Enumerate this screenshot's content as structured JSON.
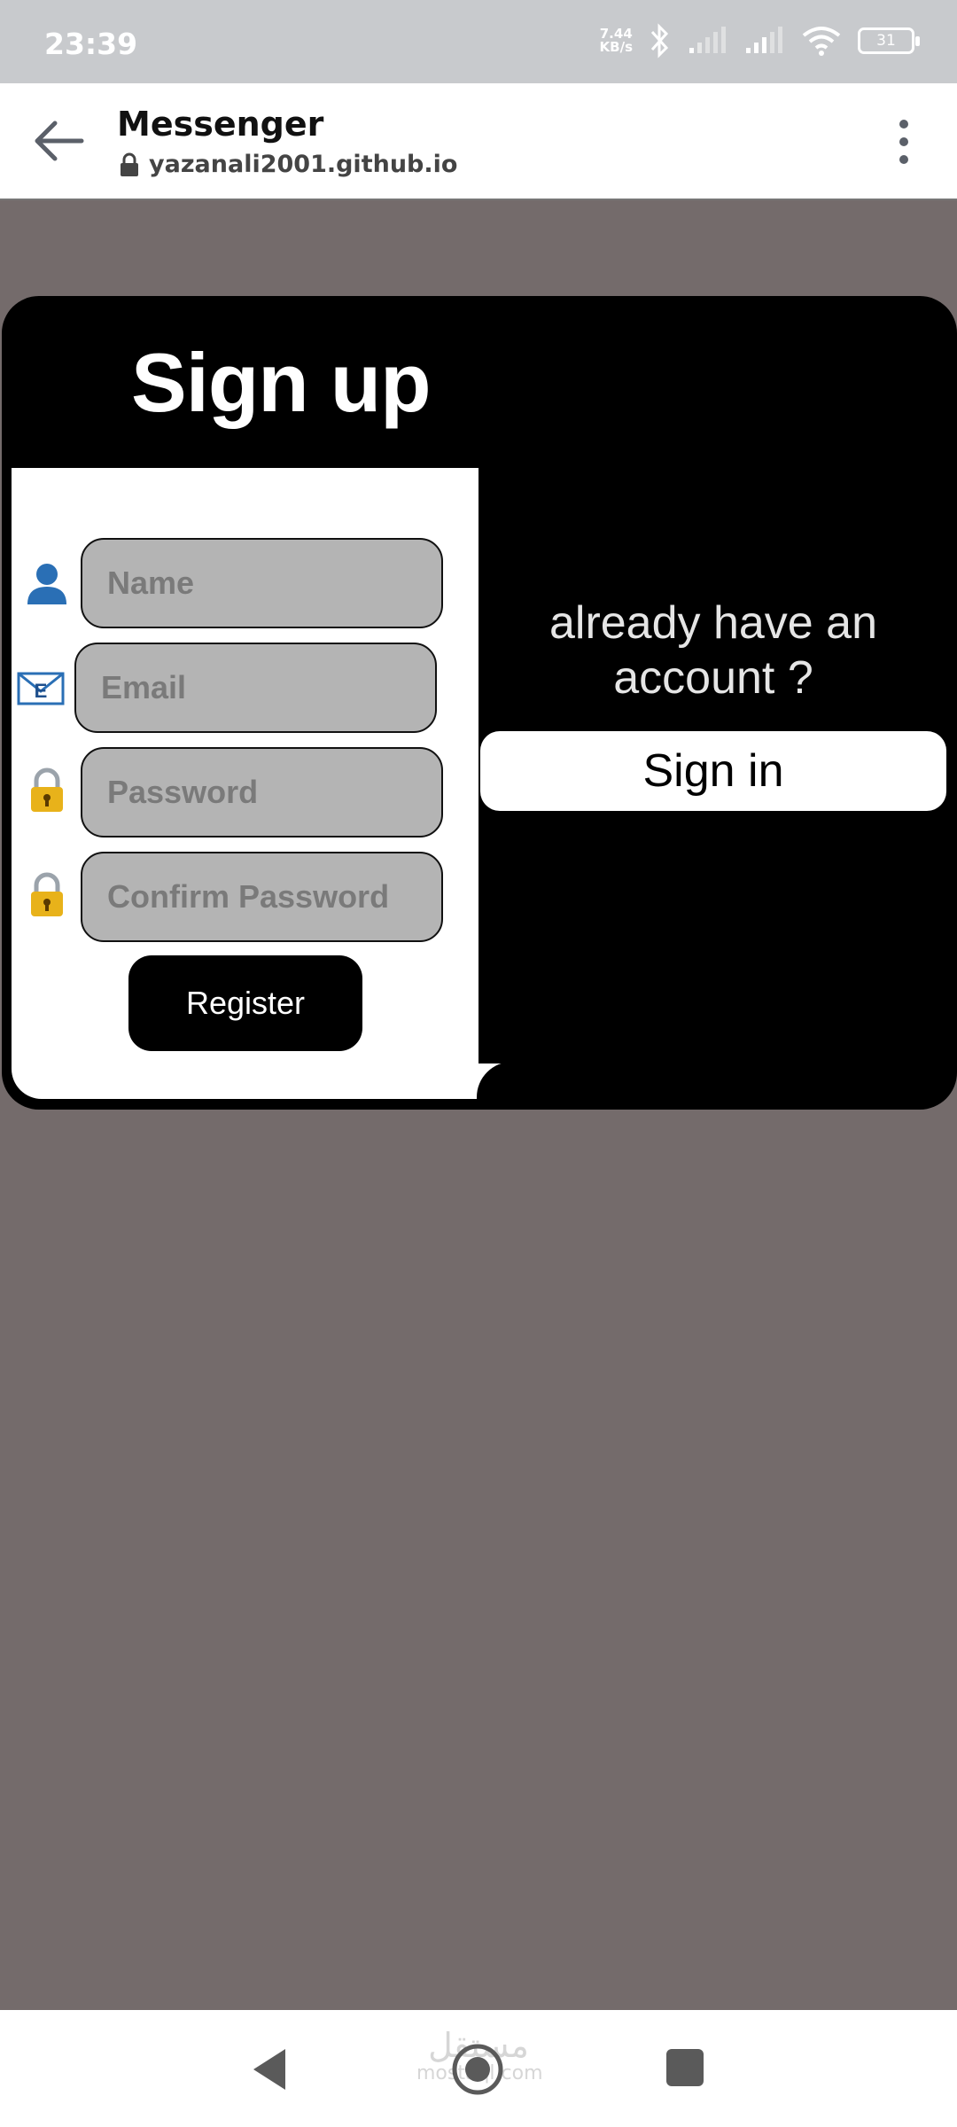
{
  "status_bar": {
    "time": "23:39",
    "net_speed_value": "7.44",
    "net_speed_unit": "KB/s",
    "battery": "31"
  },
  "app_bar": {
    "title": "Messenger",
    "url": "yazanali2001.github.io"
  },
  "page": {
    "title": "Sign up",
    "fields": {
      "name_placeholder": "Name",
      "email_placeholder": "Email",
      "password_placeholder": "Password",
      "confirm_placeholder": "Confirm Password"
    },
    "register_label": "Register",
    "prompt": "already have an account ?",
    "signin_label": "Sign in"
  },
  "nav_bar": {
    "watermark_arabic": "مستقل",
    "watermark_latin": "mostaql.com"
  },
  "colors": {
    "background": "#746b6b",
    "card": "#000000",
    "field_fill": "#b4b4b4",
    "status_bar": "#c8cacd"
  },
  "icons": [
    "user-icon",
    "email-icon",
    "lock-icon",
    "lock-icon",
    "back-arrow-icon",
    "more-vert-icon",
    "padlock-icon",
    "bluetooth-icon",
    "signal-icon",
    "wifi-icon",
    "battery-icon"
  ]
}
